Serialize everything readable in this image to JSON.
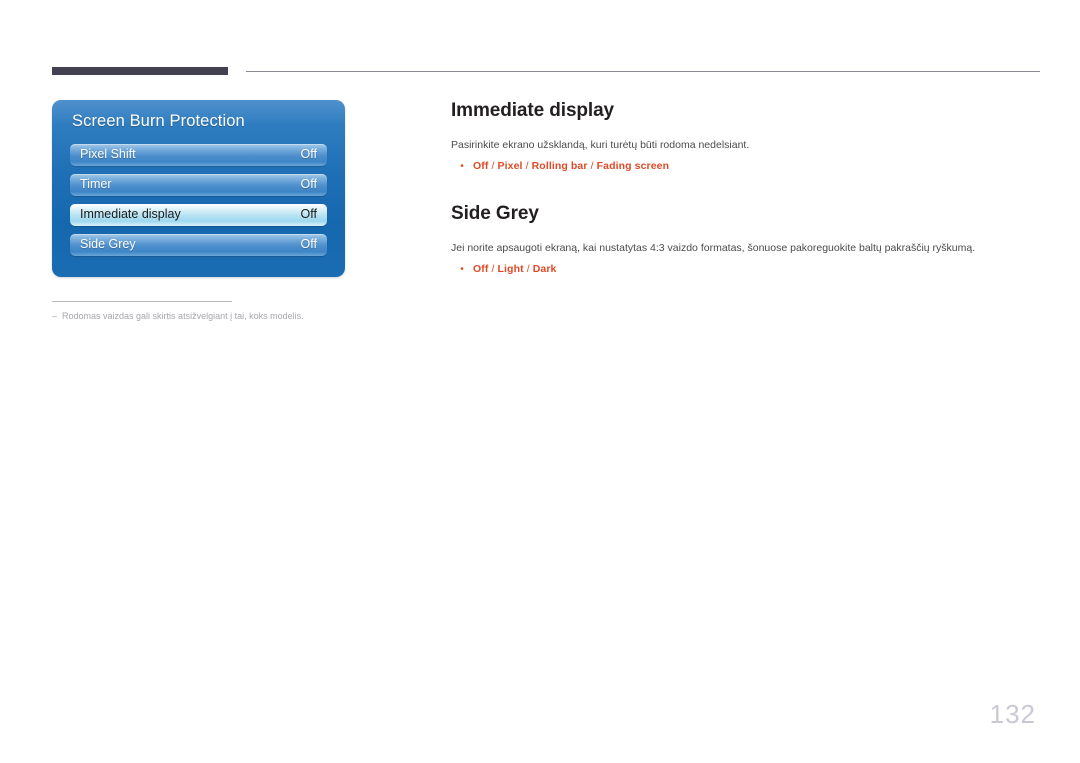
{
  "header": {
    "tab_bar": "",
    "rule": ""
  },
  "osd": {
    "title": "Screen Burn Protection",
    "rows": [
      {
        "label": "Pixel Shift",
        "value": "Off",
        "selected": false
      },
      {
        "label": "Timer",
        "value": "Off",
        "selected": false
      },
      {
        "label": "Immediate display",
        "value": "Off",
        "selected": true
      },
      {
        "label": "Side Grey",
        "value": "Off",
        "selected": false
      }
    ]
  },
  "footnote": {
    "dash": "‒",
    "text": "Rodomas vaizdas gali skirtis atsižvelgiant į tai, koks modelis."
  },
  "sections": [
    {
      "heading": "Immediate display",
      "description": "Pasirinkite ekrano užsklandą, kuri turėtų būti rodoma nedelsiant.",
      "bullet": "•",
      "options": "Off / Pixel / Rolling bar / Fading screen"
    },
    {
      "heading": "Side Grey",
      "description": "Jei norite apsaugoti ekraną, kai nustatytas 4:3 vaizdo formatas, šonuose pakoreguokite baltų pakraščių ryškumą.",
      "bullet": "•",
      "options": "Off / Light / Dark"
    }
  ],
  "page_number": "132",
  "colors": {
    "tab_bar": "#43414f",
    "accent_orange": "#e04a26",
    "panel_blue": "#1f6fb6",
    "page_number": "#c9c9d6"
  }
}
